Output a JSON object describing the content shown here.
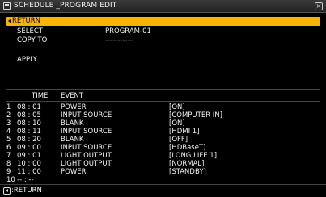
{
  "window": {
    "title": "SCHEDULE _PROGRAM EDIT",
    "close_glyph": "×"
  },
  "menu": {
    "return_label": "RETURN",
    "select_label": "SELECT",
    "select_value": "PROGRAM-01",
    "copy_label": "COPY TO",
    "copy_value": "-----------",
    "apply_label": "APPLY"
  },
  "table": {
    "headers": {
      "time": "TIME",
      "event": "EVENT"
    },
    "rows": [
      {
        "num": "1",
        "time": "08 : 01",
        "event": "POWER",
        "param": "[ON]"
      },
      {
        "num": "2",
        "time": "08 : 05",
        "event": "INPUT SOURCE",
        "param": "[COMPUTER IN]"
      },
      {
        "num": "3",
        "time": "08 : 10",
        "event": "BLANK",
        "param": "[ON]"
      },
      {
        "num": "4",
        "time": "08 : 11",
        "event": "INPUT SOURCE",
        "param": "[HDMI 1]"
      },
      {
        "num": "5",
        "time": "08 : 20",
        "event": "BLANK",
        "param": "[OFF]"
      },
      {
        "num": "6",
        "time": "09 : 00",
        "event": "INPUT SOURCE",
        "param": "[HDBaseT]"
      },
      {
        "num": "7",
        "time": "09 : 01",
        "event": "LIGHT OUTPUT",
        "param": "[LONG LIFE 1]"
      },
      {
        "num": "8",
        "time": "10 : 00",
        "event": "LIGHT OUTPUT",
        "param": "[NORMAL]"
      },
      {
        "num": "9",
        "time": "11 : 00",
        "event": "POWER",
        "param": "[STANDBY]"
      },
      {
        "num": "10",
        "time": "-- : --",
        "event": "",
        "param": ""
      }
    ]
  },
  "footer": {
    "return_label": ":RETURN"
  },
  "colors": {
    "highlight": "#f7b500",
    "background": "#000000",
    "text": "#f2f2f2"
  }
}
